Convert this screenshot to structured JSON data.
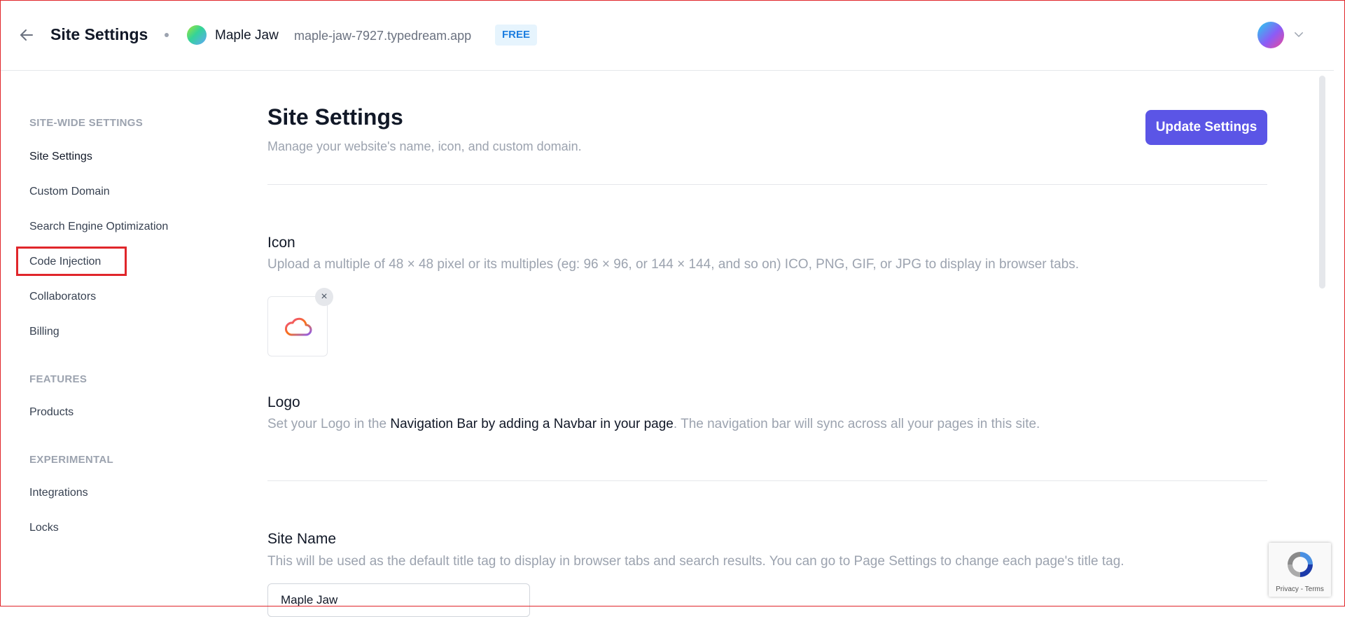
{
  "header": {
    "title": "Site Settings",
    "site_name": "Maple Jaw",
    "site_url": "maple-jaw-7927.typedream.app",
    "plan_badge": "FREE"
  },
  "sidebar": {
    "sections": [
      {
        "heading": "SITE-WIDE SETTINGS",
        "items": [
          "Site Settings",
          "Custom Domain",
          "Search Engine Optimization",
          "Code Injection",
          "Collaborators",
          "Billing"
        ]
      },
      {
        "heading": "FEATURES",
        "items": [
          "Products"
        ]
      },
      {
        "heading": "EXPERIMENTAL",
        "items": [
          "Integrations",
          "Locks"
        ]
      }
    ]
  },
  "main": {
    "title": "Site Settings",
    "subtitle": "Manage your website's name, icon, and custom domain.",
    "update_button": "Update Settings",
    "icon_section": {
      "title": "Icon",
      "description": "Upload a multiple of 48 × 48 pixel or its multiples (eg: 96 × 96, or 144 × 144, and so on) ICO, PNG, GIF, or JPG to display in browser tabs.",
      "remove_label": "×"
    },
    "logo_section": {
      "title": "Logo",
      "description_prefix": "Set your Logo in the ",
      "description_link": "Navigation Bar by adding a Navbar in your page",
      "description_suffix": ". The navigation bar will sync across all your pages in this site."
    },
    "site_name_section": {
      "title": "Site Name",
      "description": "This will be used as the default title tag to display in browser tabs and search results. You can go to Page Settings to change each page's title tag.",
      "input_value": "Maple Jaw"
    }
  },
  "recaptcha": {
    "links": "Privacy - Terms"
  },
  "colors": {
    "accent": "#5b55e6",
    "badge_text": "#1d7ee0",
    "badge_bg": "#e6f4fd",
    "highlight": "#e0262b"
  }
}
